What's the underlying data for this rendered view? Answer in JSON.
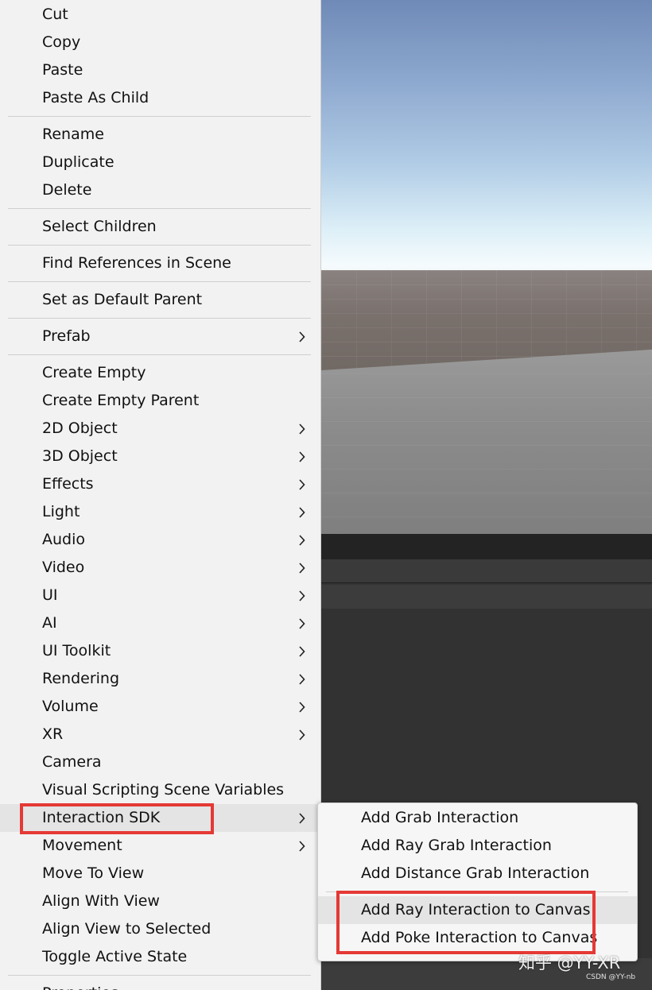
{
  "main_menu": {
    "groups": [
      [
        {
          "label": "Cut",
          "submenu": false
        },
        {
          "label": "Copy",
          "submenu": false
        },
        {
          "label": "Paste",
          "submenu": false
        },
        {
          "label": "Paste As Child",
          "submenu": false
        }
      ],
      [
        {
          "label": "Rename",
          "submenu": false
        },
        {
          "label": "Duplicate",
          "submenu": false
        },
        {
          "label": "Delete",
          "submenu": false
        }
      ],
      [
        {
          "label": "Select Children",
          "submenu": false
        }
      ],
      [
        {
          "label": "Find References in Scene",
          "submenu": false
        }
      ],
      [
        {
          "label": "Set as Default Parent",
          "submenu": false
        }
      ],
      [
        {
          "label": "Prefab",
          "submenu": true
        }
      ],
      [
        {
          "label": "Create Empty",
          "submenu": false
        },
        {
          "label": "Create Empty Parent",
          "submenu": false
        },
        {
          "label": "2D Object",
          "submenu": true
        },
        {
          "label": "3D Object",
          "submenu": true
        },
        {
          "label": "Effects",
          "submenu": true
        },
        {
          "label": "Light",
          "submenu": true
        },
        {
          "label": "Audio",
          "submenu": true
        },
        {
          "label": "Video",
          "submenu": true
        },
        {
          "label": "UI",
          "submenu": true
        },
        {
          "label": "AI",
          "submenu": true
        },
        {
          "label": "UI Toolkit",
          "submenu": true
        },
        {
          "label": "Rendering",
          "submenu": true
        },
        {
          "label": "Volume",
          "submenu": true
        },
        {
          "label": "XR",
          "submenu": true
        },
        {
          "label": "Camera",
          "submenu": false
        },
        {
          "label": "Visual Scripting Scene Variables",
          "submenu": false
        },
        {
          "label": "Interaction SDK",
          "submenu": true,
          "highlighted": true
        },
        {
          "label": "Movement",
          "submenu": true
        },
        {
          "label": "Move To View",
          "submenu": false
        },
        {
          "label": "Align With View",
          "submenu": false
        },
        {
          "label": "Align View to Selected",
          "submenu": false
        },
        {
          "label": "Toggle Active State",
          "submenu": false
        }
      ],
      [
        {
          "label": "Properties...",
          "submenu": false
        }
      ]
    ]
  },
  "sub_menu": {
    "groups": [
      [
        {
          "label": "Add Grab Interaction"
        },
        {
          "label": "Add Ray Grab Interaction"
        },
        {
          "label": "Add Distance Grab Interaction"
        }
      ],
      [
        {
          "label": "Add Ray Interaction to Canvas",
          "highlighted": true
        },
        {
          "label": "Add Poke Interaction to Canvas"
        }
      ]
    ]
  },
  "watermark": {
    "text": "知乎 @YY-XR",
    "small": "CSDN @YY-nb"
  },
  "icons": {
    "submenu_arrow": "chevron-right-icon"
  },
  "colors": {
    "menu_bg": "#f2f2f2",
    "highlight_box": "#e53935",
    "hover_bg": "#e4e4e4"
  }
}
